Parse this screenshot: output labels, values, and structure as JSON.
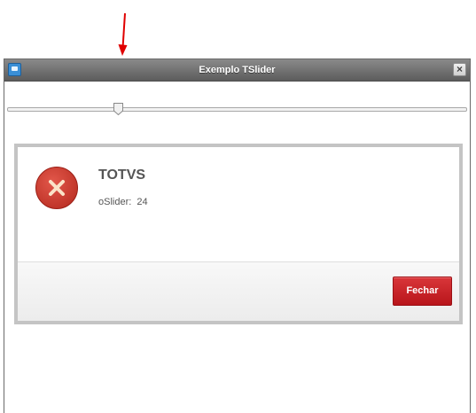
{
  "window": {
    "title": "Exemplo TSlider",
    "close_glyph": "×",
    "app_icon": "app-icon",
    "close_icon": "close-icon"
  },
  "slider": {
    "value": 24,
    "min": 0,
    "max": 100
  },
  "dialog": {
    "icon": "error-icon",
    "title": "TOTVS",
    "message": "oSlider:  24",
    "button_label": "Fechar"
  },
  "colors": {
    "titlebar": "#6f6f6f",
    "error_icon": "#c9362a",
    "button": "#c8202a",
    "annotation_arrow": "#e00000"
  }
}
